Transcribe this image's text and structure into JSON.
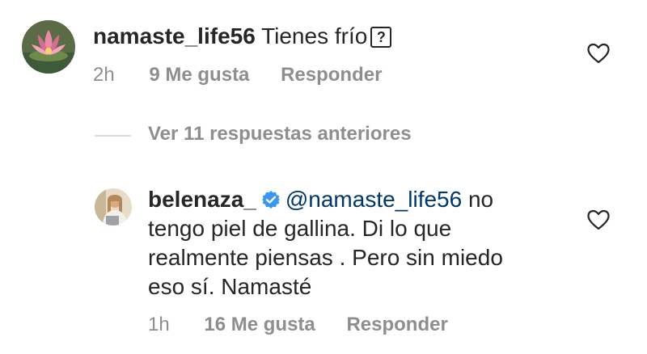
{
  "comments": [
    {
      "username": "namaste_life56",
      "text": "Tienes frío",
      "unknown_glyph": "?",
      "time": "2h",
      "likes": "9 Me gusta",
      "reply_label": "Responder"
    },
    {
      "username": "belenaza_",
      "mention": "@namaste_life56",
      "text_lines": [
        " no",
        "tengo piel de gallina. Di lo que",
        "realmente piensas . Pero sin miedo",
        "eso sí. Namasté"
      ],
      "time": "1h",
      "likes": "16 Me gusta",
      "reply_label": "Responder"
    }
  ],
  "view_replies": "Ver 11 respuestas anteriores",
  "colors": {
    "text": "#262626",
    "muted": "#8e8e8e",
    "mention": "#00376b",
    "verified": "#3897f0"
  },
  "icons": [
    "heart-icon",
    "verified-badge-icon"
  ]
}
